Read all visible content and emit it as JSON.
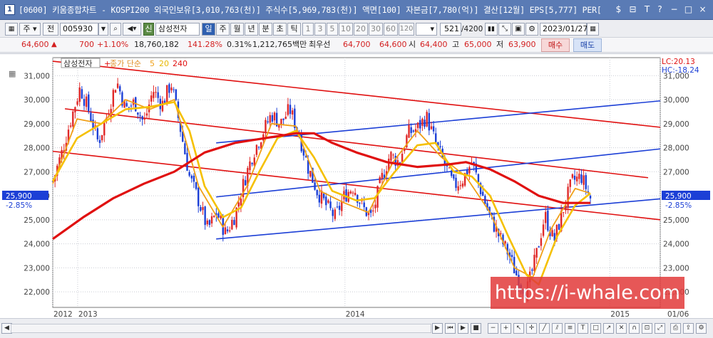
{
  "window": {
    "title": "[0600] 키움종합차트 - KOSPI200 외국인보유[3,010,763(천)] 주식수[5,969,783(천)] 액면[100] 자본금[7,780(억)] 결산[12월] EPS[5,777] PER[",
    "controls": [
      "$",
      "⊟",
      "T",
      "?",
      "−",
      "□",
      "×"
    ]
  },
  "toolbar": {
    "period_main": "주",
    "period_sub": "전",
    "code": "005930",
    "name_tag": "신",
    "name": "삼성전자",
    "periods": [
      "일",
      "주",
      "월",
      "년",
      "분",
      "초",
      "틱"
    ],
    "intervals": [
      "1",
      "3",
      "5",
      "10",
      "20",
      "30",
      "60",
      "120"
    ],
    "count": "521",
    "count_total": "/4200",
    "date": "2023/01/27"
  },
  "quote": {
    "price": "64,600",
    "change": "700",
    "change_pct": "+1.10%",
    "volume": "18,760,182",
    "vol_ratio": "141.28%",
    "turnover": "0.31%",
    "amount": "1,212,765백만",
    "best_ask_label": "최우선",
    "ask": "64,700",
    "bid": "64,600",
    "open_label": "시",
    "open": "64,400",
    "high_label": "고",
    "high": "65,000",
    "low_label": "저",
    "low": "63,900",
    "buy_label": "매수",
    "sell_label": "매도"
  },
  "legend": {
    "stock_name": "삼성전자",
    "ma_prefix": "종가 단순",
    "ma5": "5",
    "ma20": "20",
    "ma240": "240"
  },
  "right_labels": {
    "lc": "LC:20.13",
    "hc": "HC:-18.24",
    "current_price": "25,900",
    "current_change": "-2.85%"
  },
  "left_labels": {
    "current_price": "25,900",
    "current_change": "-2.85%"
  },
  "colors": {
    "up": "#e02828",
    "down": "#1c3fd6",
    "ma5": "#f0a018",
    "ma20": "#f5c000",
    "ma240": "#e01010",
    "red_channel": "#e01010",
    "blue_channel": "#1c3fd6",
    "watermark": "#e23a3a"
  },
  "watermark_text": "https://i-whale.com",
  "chart_data": {
    "type": "candlestick",
    "title": "",
    "xlabel": "",
    "ylabel": "",
    "ylim": [
      21350,
      31750
    ],
    "y_ticks": [
      22000,
      23000,
      24000,
      25000,
      26000,
      27000,
      28000,
      29000,
      30000,
      31000
    ],
    "y_tick_labels": [
      "22,000",
      "23,000",
      "24,000",
      "25,000",
      "26,000",
      "27,000",
      "28,000",
      "29,000",
      "30,000",
      "31,000"
    ],
    "x_labels": [
      {
        "label": "2012",
        "t": 0.0
      },
      {
        "label": "2013",
        "t": 0.041
      },
      {
        "label": "2014",
        "t": 0.481
      },
      {
        "label": "2015",
        "t": 0.917
      },
      {
        "label": "01/06",
        "t": 1.0
      }
    ],
    "close_path": [
      {
        "t": 0.0,
        "v": 26600
      },
      {
        "t": 0.015,
        "v": 27800
      },
      {
        "t": 0.03,
        "v": 29200
      },
      {
        "t": 0.045,
        "v": 30500
      },
      {
        "t": 0.06,
        "v": 29500
      },
      {
        "t": 0.075,
        "v": 28200
      },
      {
        "t": 0.09,
        "v": 29400
      },
      {
        "t": 0.105,
        "v": 30800
      },
      {
        "t": 0.12,
        "v": 29600
      },
      {
        "t": 0.135,
        "v": 29900
      },
      {
        "t": 0.15,
        "v": 29000
      },
      {
        "t": 0.165,
        "v": 30400
      },
      {
        "t": 0.18,
        "v": 29800
      },
      {
        "t": 0.195,
        "v": 30700
      },
      {
        "t": 0.21,
        "v": 28800
      },
      {
        "t": 0.225,
        "v": 26800
      },
      {
        "t": 0.24,
        "v": 25800
      },
      {
        "t": 0.255,
        "v": 24600
      },
      {
        "t": 0.27,
        "v": 25300
      },
      {
        "t": 0.285,
        "v": 24400
      },
      {
        "t": 0.3,
        "v": 25200
      },
      {
        "t": 0.315,
        "v": 26600
      },
      {
        "t": 0.33,
        "v": 27800
      },
      {
        "t": 0.345,
        "v": 28600
      },
      {
        "t": 0.36,
        "v": 29400
      },
      {
        "t": 0.375,
        "v": 29000
      },
      {
        "t": 0.39,
        "v": 29600
      },
      {
        "t": 0.405,
        "v": 28600
      },
      {
        "t": 0.42,
        "v": 27200
      },
      {
        "t": 0.435,
        "v": 26200
      },
      {
        "t": 0.45,
        "v": 25600
      },
      {
        "t": 0.465,
        "v": 25100
      },
      {
        "t": 0.48,
        "v": 26000
      },
      {
        "t": 0.495,
        "v": 26400
      },
      {
        "t": 0.51,
        "v": 25500
      },
      {
        "t": 0.525,
        "v": 25100
      },
      {
        "t": 0.54,
        "v": 26600
      },
      {
        "t": 0.555,
        "v": 27700
      },
      {
        "t": 0.57,
        "v": 27400
      },
      {
        "t": 0.585,
        "v": 28600
      },
      {
        "t": 0.6,
        "v": 28800
      },
      {
        "t": 0.615,
        "v": 29300
      },
      {
        "t": 0.63,
        "v": 28200
      },
      {
        "t": 0.645,
        "v": 27300
      },
      {
        "t": 0.66,
        "v": 26400
      },
      {
        "t": 0.675,
        "v": 26700
      },
      {
        "t": 0.69,
        "v": 27400
      },
      {
        "t": 0.705,
        "v": 26200
      },
      {
        "t": 0.72,
        "v": 25100
      },
      {
        "t": 0.735,
        "v": 24300
      },
      {
        "t": 0.75,
        "v": 23600
      },
      {
        "t": 0.765,
        "v": 22600
      },
      {
        "t": 0.78,
        "v": 22000
      },
      {
        "t": 0.795,
        "v": 23400
      },
      {
        "t": 0.81,
        "v": 25200
      },
      {
        "t": 0.825,
        "v": 24100
      },
      {
        "t": 0.84,
        "v": 25400
      },
      {
        "t": 0.855,
        "v": 26600
      },
      {
        "t": 0.87,
        "v": 26800
      },
      {
        "t": 0.885,
        "v": 25900
      }
    ],
    "series": [
      {
        "name": "5",
        "kind": "ma",
        "points": [
          {
            "t": 0.0,
            "v": 26500
          },
          {
            "t": 0.04,
            "v": 29200
          },
          {
            "t": 0.08,
            "v": 29000
          },
          {
            "t": 0.12,
            "v": 30000
          },
          {
            "t": 0.16,
            "v": 29600
          },
          {
            "t": 0.2,
            "v": 30000
          },
          {
            "t": 0.24,
            "v": 26400
          },
          {
            "t": 0.28,
            "v": 24700
          },
          {
            "t": 0.32,
            "v": 26400
          },
          {
            "t": 0.36,
            "v": 29000
          },
          {
            "t": 0.4,
            "v": 28900
          },
          {
            "t": 0.44,
            "v": 26200
          },
          {
            "t": 0.48,
            "v": 25700
          },
          {
            "t": 0.52,
            "v": 25300
          },
          {
            "t": 0.56,
            "v": 27400
          },
          {
            "t": 0.6,
            "v": 28700
          },
          {
            "t": 0.64,
            "v": 27600
          },
          {
            "t": 0.68,
            "v": 26800
          },
          {
            "t": 0.72,
            "v": 25300
          },
          {
            "t": 0.76,
            "v": 23000
          },
          {
            "t": 0.79,
            "v": 22600
          },
          {
            "t": 0.82,
            "v": 24600
          },
          {
            "t": 0.86,
            "v": 26300
          },
          {
            "t": 0.885,
            "v": 26100
          }
        ]
      },
      {
        "name": "20",
        "kind": "ma",
        "points": [
          {
            "t": 0.0,
            "v": 26600
          },
          {
            "t": 0.04,
            "v": 28400
          },
          {
            "t": 0.08,
            "v": 29000
          },
          {
            "t": 0.12,
            "v": 29600
          },
          {
            "t": 0.16,
            "v": 29700
          },
          {
            "t": 0.2,
            "v": 29900
          },
          {
            "t": 0.225,
            "v": 28700
          },
          {
            "t": 0.25,
            "v": 26400
          },
          {
            "t": 0.28,
            "v": 25100
          },
          {
            "t": 0.31,
            "v": 25500
          },
          {
            "t": 0.34,
            "v": 27000
          },
          {
            "t": 0.37,
            "v": 28400
          },
          {
            "t": 0.4,
            "v": 28700
          },
          {
            "t": 0.43,
            "v": 27600
          },
          {
            "t": 0.46,
            "v": 26200
          },
          {
            "t": 0.5,
            "v": 25800
          },
          {
            "t": 0.53,
            "v": 25900
          },
          {
            "t": 0.56,
            "v": 26900
          },
          {
            "t": 0.6,
            "v": 28100
          },
          {
            "t": 0.63,
            "v": 28200
          },
          {
            "t": 0.66,
            "v": 27000
          },
          {
            "t": 0.69,
            "v": 26800
          },
          {
            "t": 0.72,
            "v": 26000
          },
          {
            "t": 0.75,
            "v": 24300
          },
          {
            "t": 0.78,
            "v": 22700
          },
          {
            "t": 0.8,
            "v": 22300
          },
          {
            "t": 0.83,
            "v": 24300
          },
          {
            "t": 0.86,
            "v": 25600
          },
          {
            "t": 0.885,
            "v": 26100
          }
        ]
      },
      {
        "name": "240",
        "kind": "ma",
        "points": [
          {
            "t": 0.0,
            "v": 24200
          },
          {
            "t": 0.05,
            "v": 25100
          },
          {
            "t": 0.1,
            "v": 25900
          },
          {
            "t": 0.15,
            "v": 26500
          },
          {
            "t": 0.2,
            "v": 27000
          },
          {
            "t": 0.25,
            "v": 27800
          },
          {
            "t": 0.3,
            "v": 28200
          },
          {
            "t": 0.35,
            "v": 28400
          },
          {
            "t": 0.4,
            "v": 28600
          },
          {
            "t": 0.43,
            "v": 28600
          },
          {
            "t": 0.46,
            "v": 28200
          },
          {
            "t": 0.5,
            "v": 27800
          },
          {
            "t": 0.55,
            "v": 27400
          },
          {
            "t": 0.6,
            "v": 27200
          },
          {
            "t": 0.65,
            "v": 27300
          },
          {
            "t": 0.68,
            "v": 27400
          },
          {
            "t": 0.72,
            "v": 27100
          },
          {
            "t": 0.76,
            "v": 26600
          },
          {
            "t": 0.8,
            "v": 26000
          },
          {
            "t": 0.84,
            "v": 25700
          },
          {
            "t": 0.885,
            "v": 25700
          }
        ]
      }
    ],
    "trendlines": [
      {
        "color": "red",
        "from": {
          "t": 0.0,
          "v": 31600
        },
        "to": {
          "t": 1.0,
          "v": 28850
        }
      },
      {
        "color": "red",
        "from": {
          "t": 0.02,
          "v": 29620
        },
        "to": {
          "t": 0.98,
          "v": 26750
        }
      },
      {
        "color": "red",
        "from": {
          "t": 0.0,
          "v": 27850
        },
        "to": {
          "t": 1.0,
          "v": 25000
        }
      },
      {
        "color": "blue",
        "from": {
          "t": 0.269,
          "v": 24200
        },
        "to": {
          "t": 1.0,
          "v": 25870
        }
      },
      {
        "color": "blue",
        "from": {
          "t": 0.269,
          "v": 25950
        },
        "to": {
          "t": 1.0,
          "v": 27950
        }
      },
      {
        "color": "blue",
        "from": {
          "t": 0.269,
          "v": 28200
        },
        "to": {
          "t": 1.0,
          "v": 29950
        }
      }
    ],
    "last_price": 25900,
    "last_change_pct": "-2.85%",
    "grid": true
  }
}
